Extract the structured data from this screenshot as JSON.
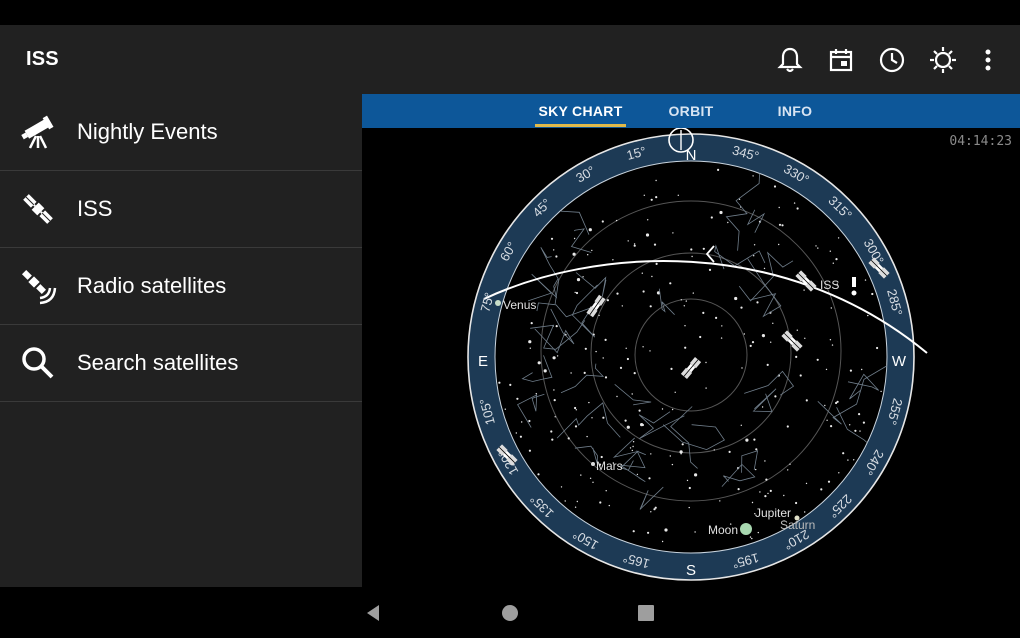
{
  "app": {
    "title": "ISS"
  },
  "appbar_icons": [
    "bell-icon",
    "calendar-icon",
    "clock-icon",
    "brightness-icon",
    "more-vert-icon"
  ],
  "drawer": {
    "items": [
      {
        "label": "Nightly Events",
        "icon": "telescope-icon"
      },
      {
        "label": "ISS",
        "icon": "satellite-icon"
      },
      {
        "label": "Radio satellites",
        "icon": "radio-satellite-icon"
      },
      {
        "label": "Search satellites",
        "icon": "search-icon"
      }
    ]
  },
  "tabs": [
    {
      "label": "SKY CHART",
      "active": true
    },
    {
      "label": "ORBIT",
      "active": false
    },
    {
      "label": "INFO",
      "active": false
    }
  ],
  "sky_chart": {
    "time": "04:14:23",
    "compass": {
      "n": "N",
      "e": "E",
      "s": "S",
      "w": "W"
    },
    "degree_labels": [
      "15°",
      "30°",
      "45°",
      "60°",
      "75°",
      "105°",
      "120°",
      "135°",
      "150°",
      "165°",
      "195°",
      "210°",
      "225°",
      "240°",
      "255°",
      "285°",
      "300°",
      "315°",
      "330°",
      "345°"
    ],
    "objects": {
      "venus": "Venus",
      "mars": "Mars",
      "moon": "Moon",
      "jupiter": "Jupiter",
      "saturn": "Saturn",
      "iss": "ISS"
    }
  },
  "colors": {
    "tab_bar": "#0d5799",
    "tab_indicator": "#e0b94a",
    "appbar": "#212121",
    "ring": "#1d3a55"
  }
}
